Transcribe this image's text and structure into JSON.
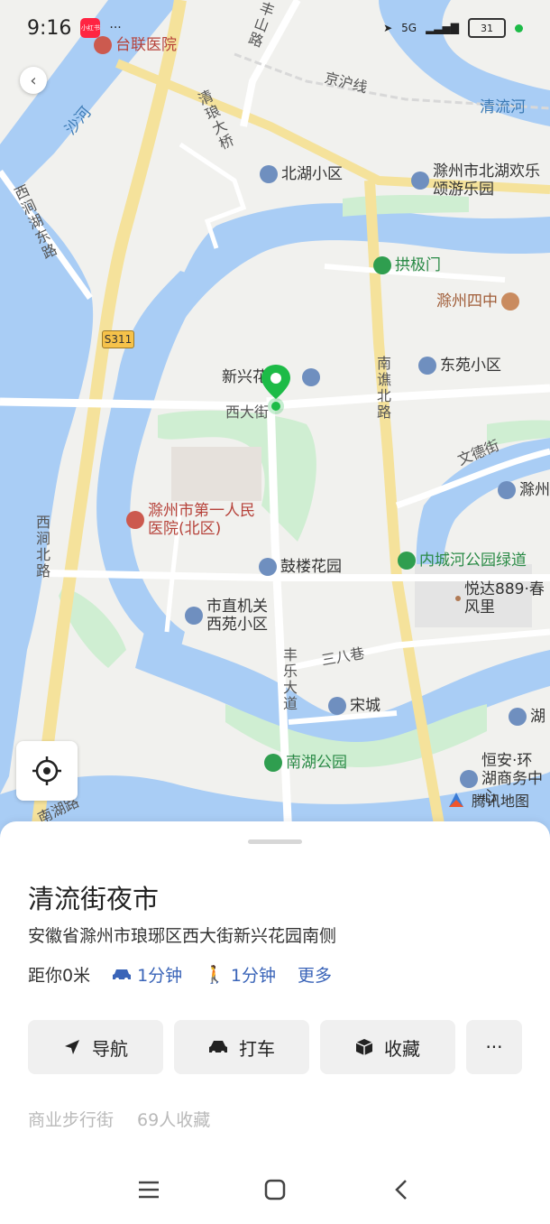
{
  "status_bar": {
    "time": "9:16",
    "app_badge": "小红书",
    "more": "···",
    "network": "5G",
    "battery": "31"
  },
  "map": {
    "pois": {
      "hospital_tailian": "台联医院",
      "beihu_xiaoqu": "北湖小区",
      "beihu_park": "滁州市北湖欢乐颂游乐园",
      "gongji_gate": "拱极门",
      "chuzhou_four": "滁州四中",
      "dongyuan": "东苑小区",
      "xinxing": "新兴花",
      "first_hospital": "滁州市第一人民医院(北区)",
      "gulou": "鼓楼花园",
      "neichenghe": "内城河公园绿道",
      "yueda": "悦达889·春风里",
      "shizhi": "市直机关西苑小区",
      "songcheng": "宋城",
      "nanhu_park": "南湖公园",
      "hengan": "恒安·环湖商务中心",
      "chuzhou_right": "滁州",
      "hu_right": "湖"
    },
    "roads": {
      "xida": "西大街",
      "nanqiao_bei": "南谯北路",
      "wende": "文德街",
      "fengle": "丰乐大道",
      "sanba": "三八巷",
      "xijian_bei": "西涧北路",
      "xijian_hudong": "西涧湖东路",
      "qinglang_bridge": "清琅大桥",
      "fengshan": "丰山路",
      "jinghu": "京沪线",
      "nanhu_road": "南湖路",
      "s311": "S311"
    },
    "water": {
      "shahe": "沙河",
      "qingliu": "清流河"
    },
    "provider": "腾讯地图"
  },
  "place": {
    "name": "清流街夜市",
    "address": "安徽省滁州市琅琊区西大街新兴花园南侧",
    "distance": "距你0米",
    "drive_time": "1分钟",
    "walk_time": "1分钟",
    "more": "更多"
  },
  "actions": {
    "navigate": "导航",
    "taxi": "打车",
    "favorite": "收藏",
    "more": "···"
  },
  "tags": {
    "category": "商业步行街",
    "favorites": "69人收藏"
  },
  "colors": {
    "water": "#a9cdf5",
    "park": "#cfeed2",
    "road": "#ffffff",
    "main_road": "#f5e29b",
    "pin": "#1dbb47",
    "link": "#3a64b8"
  }
}
